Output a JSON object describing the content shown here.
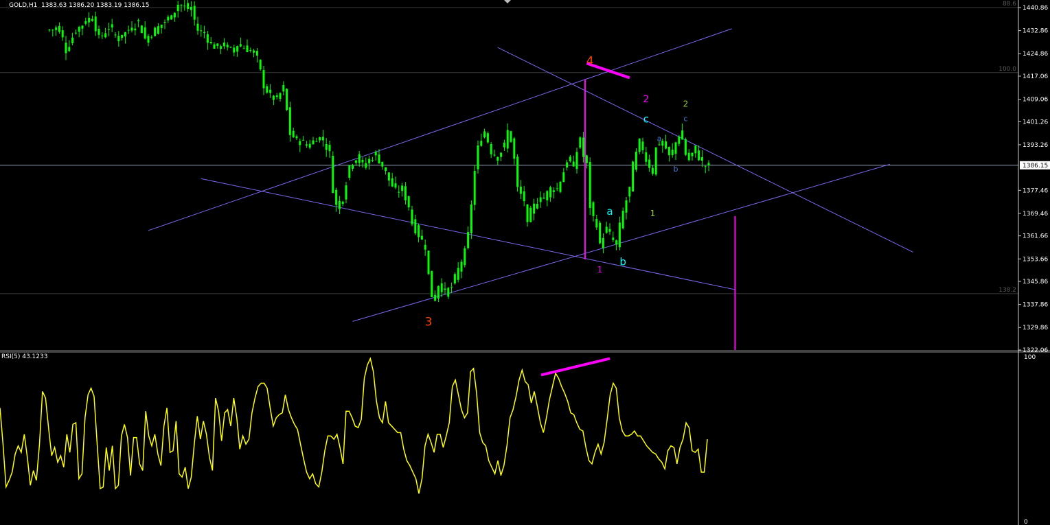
{
  "header": {
    "symbol": "GOLD,H1",
    "ohlc": "1383.63 1386.20 1383.19 1386.15",
    "rsi_label": "RSI(5) 43.1233"
  },
  "colors": {
    "background": "#000000",
    "candle": "#00ff00",
    "trendline": "#7b68ee",
    "rsi": "#ffff00",
    "magenta": "#ff00ff",
    "current_price_line": "#9aa4b8",
    "fib_line": "#3a3a3a",
    "wave_big": "#ff4000",
    "wave_cyan": "#00ffff",
    "wave_olive": "#9acd32",
    "wave_blue": "#4682d4"
  },
  "price_axis": {
    "ticks": [
      "1440.86",
      "1432.86",
      "1424.86",
      "1417.06",
      "1409.06",
      "1401.26",
      "1393.26",
      "1377.46",
      "1369.46",
      "1361.66",
      "1353.66",
      "1345.86",
      "1337.86",
      "1329.86",
      "1322.06"
    ],
    "current_price": "1386.15",
    "range": [
      1322.06,
      1443.0
    ]
  },
  "rsi_axis": {
    "top": "100",
    "bottom": "0",
    "range": [
      0,
      100
    ]
  },
  "fib_levels": [
    {
      "label": "88.6",
      "price": 1440.86
    },
    {
      "label": "100.0",
      "price": 1418.3
    },
    {
      "label": "138.2",
      "price": 1341.6
    }
  ],
  "wave_labels": [
    {
      "text": "4",
      "price": 1421.0,
      "bar": 164,
      "color": "wave_big",
      "size": 17
    },
    {
      "text": "3",
      "price": 1330.5,
      "bar": 115,
      "color": "wave_big",
      "size": 17
    },
    {
      "text": "2",
      "price": 1408.0,
      "bar": 181,
      "color": "magenta",
      "size": 14
    },
    {
      "text": "1",
      "price": 1349.0,
      "bar": 167,
      "color": "magenta",
      "size": 12
    },
    {
      "text": "c",
      "price": 1401.0,
      "bar": 181,
      "color": "wave_cyan",
      "size": 15
    },
    {
      "text": "a",
      "price": 1369.0,
      "bar": 170,
      "color": "wave_cyan",
      "size": 15
    },
    {
      "text": "b",
      "price": 1351.5,
      "bar": 174,
      "color": "wave_cyan",
      "size": 15
    },
    {
      "text": "2",
      "price": 1406.5,
      "bar": 193,
      "color": "wave_olive",
      "size": 12
    },
    {
      "text": "1",
      "price": 1368.5,
      "bar": 183,
      "color": "wave_olive",
      "size": 12
    },
    {
      "text": "a",
      "price": 1394.5,
      "bar": 185,
      "color": "wave_blue",
      "size": 11
    },
    {
      "text": "c",
      "price": 1401.5,
      "bar": 193,
      "color": "wave_blue",
      "size": 11
    },
    {
      "text": "b",
      "price": 1384.0,
      "bar": 190,
      "color": "wave_blue",
      "size": 11
    }
  ],
  "chart_data": [
    {
      "type": "candlestick",
      "title": "GOLD,H1",
      "y_range": [
        1322.06,
        1443.0
      ],
      "close_path": [
        {
          "bar": 0,
          "price": 1433
        },
        {
          "bar": 3,
          "price": 1434
        },
        {
          "bar": 5,
          "price": 1426
        },
        {
          "bar": 8,
          "price": 1433
        },
        {
          "bar": 11,
          "price": 1436
        },
        {
          "bar": 13,
          "price": 1438
        },
        {
          "bar": 15,
          "price": 1430
        },
        {
          "bar": 18,
          "price": 1434
        },
        {
          "bar": 21,
          "price": 1430
        },
        {
          "bar": 24,
          "price": 1433
        },
        {
          "bar": 27,
          "price": 1436
        },
        {
          "bar": 29,
          "price": 1430
        },
        {
          "bar": 32,
          "price": 1433
        },
        {
          "bar": 35,
          "price": 1436
        },
        {
          "bar": 37,
          "price": 1438
        },
        {
          "bar": 39,
          "price": 1442
        },
        {
          "bar": 41,
          "price": 1441
        },
        {
          "bar": 43,
          "price": 1440
        },
        {
          "bar": 45,
          "price": 1433
        },
        {
          "bar": 47,
          "price": 1432
        },
        {
          "bar": 49,
          "price": 1428
        },
        {
          "bar": 51,
          "price": 1427
        },
        {
          "bar": 53,
          "price": 1428
        },
        {
          "bar": 55,
          "price": 1426
        },
        {
          "bar": 57,
          "price": 1428
        },
        {
          "bar": 59,
          "price": 1427
        },
        {
          "bar": 61,
          "price": 1426
        },
        {
          "bar": 63,
          "price": 1423
        },
        {
          "bar": 65,
          "price": 1414
        },
        {
          "bar": 67,
          "price": 1410
        },
        {
          "bar": 69,
          "price": 1409
        },
        {
          "bar": 71,
          "price": 1413
        },
        {
          "bar": 72,
          "price": 1405
        },
        {
          "bar": 73,
          "price": 1397
        },
        {
          "bar": 75,
          "price": 1395
        },
        {
          "bar": 77,
          "price": 1394
        },
        {
          "bar": 79,
          "price": 1393
        },
        {
          "bar": 81,
          "price": 1396
        },
        {
          "bar": 83,
          "price": 1395
        },
        {
          "bar": 85,
          "price": 1390
        },
        {
          "bar": 86,
          "price": 1378
        },
        {
          "bar": 87,
          "price": 1372
        },
        {
          "bar": 89,
          "price": 1375
        },
        {
          "bar": 91,
          "price": 1386
        },
        {
          "bar": 93,
          "price": 1389
        },
        {
          "bar": 95,
          "price": 1386
        },
        {
          "bar": 97,
          "price": 1388
        },
        {
          "bar": 99,
          "price": 1390
        },
        {
          "bar": 101,
          "price": 1386
        },
        {
          "bar": 103,
          "price": 1381
        },
        {
          "bar": 105,
          "price": 1377
        },
        {
          "bar": 107,
          "price": 1378
        },
        {
          "bar": 109,
          "price": 1372
        },
        {
          "bar": 110,
          "price": 1366
        },
        {
          "bar": 112,
          "price": 1362
        },
        {
          "bar": 114,
          "price": 1358
        },
        {
          "bar": 115,
          "price": 1348
        },
        {
          "bar": 116,
          "price": 1341
        },
        {
          "bar": 117,
          "price": 1340
        },
        {
          "bar": 118,
          "price": 1345
        },
        {
          "bar": 120,
          "price": 1342
        },
        {
          "bar": 122,
          "price": 1344
        },
        {
          "bar": 124,
          "price": 1350
        },
        {
          "bar": 126,
          "price": 1356
        },
        {
          "bar": 127,
          "price": 1362
        },
        {
          "bar": 129,
          "price": 1384
        },
        {
          "bar": 130,
          "price": 1392
        },
        {
          "bar": 131,
          "price": 1396
        },
        {
          "bar": 132,
          "price": 1398
        },
        {
          "bar": 134,
          "price": 1391
        },
        {
          "bar": 136,
          "price": 1389
        },
        {
          "bar": 138,
          "price": 1393
        },
        {
          "bar": 139,
          "price": 1398
        },
        {
          "bar": 140,
          "price": 1395
        },
        {
          "bar": 141,
          "price": 1388
        },
        {
          "bar": 142,
          "price": 1378
        },
        {
          "bar": 144,
          "price": 1374
        },
        {
          "bar": 145,
          "price": 1365
        },
        {
          "bar": 146,
          "price": 1370
        },
        {
          "bar": 147,
          "price": 1372
        },
        {
          "bar": 148,
          "price": 1374
        },
        {
          "bar": 150,
          "price": 1375
        },
        {
          "bar": 152,
          "price": 1378
        },
        {
          "bar": 154,
          "price": 1378
        },
        {
          "bar": 156,
          "price": 1384
        },
        {
          "bar": 157,
          "price": 1388
        },
        {
          "bar": 159,
          "price": 1386
        },
        {
          "bar": 161,
          "price": 1396
        },
        {
          "bar": 162,
          "price": 1389
        },
        {
          "bar": 163,
          "price": 1386
        },
        {
          "bar": 164,
          "price": 1372
        },
        {
          "bar": 165,
          "price": 1368
        },
        {
          "bar": 166,
          "price": 1366
        },
        {
          "bar": 167,
          "price": 1358
        },
        {
          "bar": 168,
          "price": 1362
        },
        {
          "bar": 169,
          "price": 1364
        },
        {
          "bar": 170,
          "price": 1362
        },
        {
          "bar": 171,
          "price": 1360
        },
        {
          "bar": 172,
          "price": 1358
        },
        {
          "bar": 173,
          "price": 1365
        },
        {
          "bar": 174,
          "price": 1370
        },
        {
          "bar": 176,
          "price": 1378
        },
        {
          "bar": 177,
          "price": 1386
        },
        {
          "bar": 178,
          "price": 1390
        },
        {
          "bar": 179,
          "price": 1394
        },
        {
          "bar": 180,
          "price": 1392
        },
        {
          "bar": 181,
          "price": 1388
        },
        {
          "bar": 182,
          "price": 1386
        },
        {
          "bar": 183,
          "price": 1384
        },
        {
          "bar": 184,
          "price": 1392
        },
        {
          "bar": 185,
          "price": 1394
        },
        {
          "bar": 187,
          "price": 1392
        },
        {
          "bar": 188,
          "price": 1389
        },
        {
          "bar": 189,
          "price": 1391
        },
        {
          "bar": 190,
          "price": 1394
        },
        {
          "bar": 191,
          "price": 1397
        },
        {
          "bar": 192,
          "price": 1395
        },
        {
          "bar": 193,
          "price": 1390
        },
        {
          "bar": 194,
          "price": 1388
        },
        {
          "bar": 195,
          "price": 1390
        },
        {
          "bar": 196,
          "price": 1392
        },
        {
          "bar": 197,
          "price": 1389
        },
        {
          "bar": 198,
          "price": 1387
        },
        {
          "bar": 199,
          "price": 1386
        },
        {
          "bar": 200,
          "price": 1385
        }
      ]
    },
    {
      "type": "line",
      "title": "RSI(5) 43.1233",
      "y_range": [
        0,
        100
      ],
      "series": [
        {
          "values": [
            69,
            47,
            21,
            25,
            30,
            41,
            46,
            42,
            53,
            39,
            22,
            31,
            25,
            47,
            79,
            75,
            57,
            40,
            45,
            36,
            40,
            33,
            53,
            42,
            59,
            60,
            26,
            29,
            63,
            77,
            81,
            76,
            47,
            20,
            21,
            45,
            31,
            46,
            20,
            22,
            52,
            59,
            51,
            28,
            51,
            51,
            35,
            31,
            67,
            52,
            46,
            53,
            41,
            34,
            58,
            69,
            42,
            43,
            61,
            29,
            27,
            33,
            20,
            27,
            47,
            64,
            50,
            61,
            53,
            39,
            31,
            75,
            67,
            49,
            66,
            68,
            58,
            75,
            63,
            44,
            52,
            47,
            50,
            66,
            75,
            82,
            84,
            84,
            81,
            69,
            58,
            63,
            65,
            66,
            77,
            68,
            63,
            59,
            56,
            47,
            38,
            30,
            26,
            29,
            23,
            21,
            30,
            43,
            52,
            52,
            50,
            53,
            45,
            35,
            67,
            67,
            63,
            58,
            57,
            62,
            87,
            95,
            99,
            91,
            73,
            63,
            60,
            73,
            60,
            58,
            56,
            54,
            54,
            44,
            37,
            34,
            30,
            26,
            17,
            26,
            46,
            53,
            48,
            42,
            53,
            53,
            45,
            52,
            60,
            82,
            86,
            77,
            68,
            63,
            66,
            91,
            93,
            78,
            54,
            48,
            46,
            37,
            33,
            29,
            37,
            28,
            34,
            46,
            63,
            68,
            76,
            86,
            92,
            85,
            83,
            72,
            79,
            70,
            60,
            54,
            63,
            74,
            82,
            90,
            87,
            82,
            78,
            73,
            66,
            65,
            60,
            56,
            55,
            45,
            37,
            35,
            42,
            47,
            41,
            48,
            62,
            77,
            84,
            81,
            63,
            55,
            52,
            52,
            53,
            55,
            52,
            52,
            49,
            46,
            44,
            42,
            41,
            38,
            36,
            32,
            43,
            46,
            45,
            35,
            45,
            50,
            60,
            57,
            43,
            42,
            44,
            30,
            30,
            50
          ]
        }
      ]
    }
  ]
}
